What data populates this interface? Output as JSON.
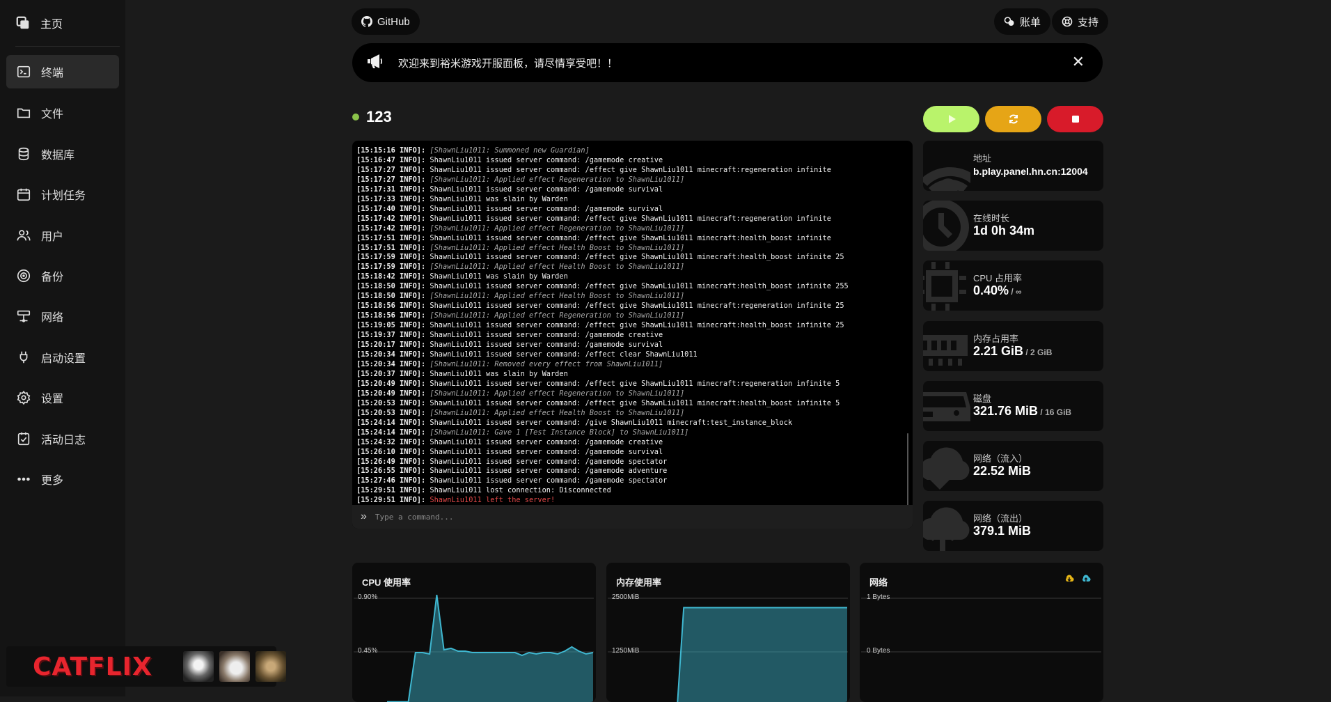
{
  "sidebar": {
    "home_label": "主页",
    "items": [
      {
        "label": "终端"
      },
      {
        "label": "文件"
      },
      {
        "label": "数据库"
      },
      {
        "label": "计划任务"
      },
      {
        "label": "用户"
      },
      {
        "label": "备份"
      },
      {
        "label": "网络"
      },
      {
        "label": "启动设置"
      },
      {
        "label": "设置"
      },
      {
        "label": "活动日志"
      },
      {
        "label": "更多"
      }
    ],
    "ad_text": "CATFLIX"
  },
  "topbar": {
    "github_label": "GitHub",
    "billing_label": "账单",
    "support_label": "支持"
  },
  "announcement": {
    "text": "欢迎来到裕米游戏开服面板，请尽情享受吧！！",
    "close_symbol": "✕"
  },
  "server": {
    "name": "123",
    "status_color": "#8bc34a"
  },
  "controls": {
    "start_color": "#b9f36b",
    "restart_color": "#e6a516",
    "stop_color": "#d81b2a"
  },
  "console": {
    "lines": [
      {
        "ts": "[15:15:16 INFO]:",
        "msg": " [ShawnLiu1011: Summoned new Guardian]",
        "style": "italic"
      },
      {
        "ts": "[15:16:47 INFO]:",
        "msg": " ShawnLiu1011 issued server command: /gamemode creative",
        "style": ""
      },
      {
        "ts": "[15:17:27 INFO]:",
        "msg": " ShawnLiu1011 issued server command: /effect give ShawnLiu1011 minecraft:regeneration infinite",
        "style": ""
      },
      {
        "ts": "[15:17:27 INFO]:",
        "msg": " [ShawnLiu1011: Applied effect Regeneration to ShawnLiu1011]",
        "style": "italic"
      },
      {
        "ts": "[15:17:31 INFO]:",
        "msg": " ShawnLiu1011 issued server command: /gamemode survival",
        "style": ""
      },
      {
        "ts": "[15:17:33 INFO]:",
        "msg": " ShawnLiu1011 was slain by Warden",
        "style": ""
      },
      {
        "ts": "[15:17:40 INFO]:",
        "msg": " ShawnLiu1011 issued server command: /gamemode survival",
        "style": ""
      },
      {
        "ts": "[15:17:42 INFO]:",
        "msg": " ShawnLiu1011 issued server command: /effect give ShawnLiu1011 minecraft:regeneration infinite",
        "style": ""
      },
      {
        "ts": "[15:17:42 INFO]:",
        "msg": " [ShawnLiu1011: Applied effect Regeneration to ShawnLiu1011]",
        "style": "italic"
      },
      {
        "ts": "[15:17:51 INFO]:",
        "msg": " ShawnLiu1011 issued server command: /effect give ShawnLiu1011 minecraft:health_boost infinite",
        "style": ""
      },
      {
        "ts": "[15:17:51 INFO]:",
        "msg": " [ShawnLiu1011: Applied effect Health Boost to ShawnLiu1011]",
        "style": "italic"
      },
      {
        "ts": "[15:17:59 INFO]:",
        "msg": " ShawnLiu1011 issued server command: /effect give ShawnLiu1011 minecraft:health_boost infinite 25",
        "style": ""
      },
      {
        "ts": "[15:17:59 INFO]:",
        "msg": " [ShawnLiu1011: Applied effect Health Boost to ShawnLiu1011]",
        "style": "italic"
      },
      {
        "ts": "[15:18:42 INFO]:",
        "msg": " ShawnLiu1011 was slain by Warden",
        "style": ""
      },
      {
        "ts": "[15:18:50 INFO]:",
        "msg": " ShawnLiu1011 issued server command: /effect give ShawnLiu1011 minecraft:health_boost infinite 255",
        "style": ""
      },
      {
        "ts": "[15:18:50 INFO]:",
        "msg": " [ShawnLiu1011: Applied effect Health Boost to ShawnLiu1011]",
        "style": "italic"
      },
      {
        "ts": "[15:18:56 INFO]:",
        "msg": " ShawnLiu1011 issued server command: /effect give ShawnLiu1011 minecraft:regeneration infinite 25",
        "style": ""
      },
      {
        "ts": "[15:18:56 INFO]:",
        "msg": " [ShawnLiu1011: Applied effect Regeneration to ShawnLiu1011]",
        "style": "italic"
      },
      {
        "ts": "[15:19:05 INFO]:",
        "msg": " ShawnLiu1011 issued server command: /effect give ShawnLiu1011 minecraft:health_boost infinite 25",
        "style": ""
      },
      {
        "ts": "[15:19:37 INFO]:",
        "msg": " ShawnLiu1011 issued server command: /gamemode creative",
        "style": ""
      },
      {
        "ts": "[15:20:17 INFO]:",
        "msg": " ShawnLiu1011 issued server command: /gamemode survival",
        "style": ""
      },
      {
        "ts": "[15:20:34 INFO]:",
        "msg": " ShawnLiu1011 issued server command: /effect clear ShawnLiu1011",
        "style": ""
      },
      {
        "ts": "[15:20:34 INFO]:",
        "msg": " [ShawnLiu1011: Removed every effect from ShawnLiu1011]",
        "style": "italic"
      },
      {
        "ts": "[15:20:37 INFO]:",
        "msg": " ShawnLiu1011 was slain by Warden",
        "style": ""
      },
      {
        "ts": "[15:20:49 INFO]:",
        "msg": " ShawnLiu1011 issued server command: /effect give ShawnLiu1011 minecraft:regeneration infinite 5",
        "style": ""
      },
      {
        "ts": "[15:20:49 INFO]:",
        "msg": " [ShawnLiu1011: Applied effect Regeneration to ShawnLiu1011]",
        "style": "italic"
      },
      {
        "ts": "[15:20:53 INFO]:",
        "msg": " ShawnLiu1011 issued server command: /effect give ShawnLiu1011 minecraft:health_boost infinite 5",
        "style": ""
      },
      {
        "ts": "[15:20:53 INFO]:",
        "msg": " [ShawnLiu1011: Applied effect Health Boost to ShawnLiu1011]",
        "style": "italic"
      },
      {
        "ts": "[15:24:14 INFO]:",
        "msg": " ShawnLiu1011 issued server command: /give ShawnLiu1011 minecraft:test_instance_block",
        "style": ""
      },
      {
        "ts": "[15:24:14 INFO]:",
        "msg": " [ShawnLiu1011: Gave 1 [Test Instance Block] to ShawnLiu1011]",
        "style": "italic"
      },
      {
        "ts": "[15:24:32 INFO]:",
        "msg": " ShawnLiu1011 issued server command: /gamemode creative",
        "style": ""
      },
      {
        "ts": "[15:26:10 INFO]:",
        "msg": " ShawnLiu1011 issued server command: /gamemode survival",
        "style": ""
      },
      {
        "ts": "[15:26:49 INFO]:",
        "msg": " ShawnLiu1011 issued server command: /gamemode spectator",
        "style": ""
      },
      {
        "ts": "[15:26:55 INFO]:",
        "msg": " ShawnLiu1011 issued server command: /gamemode adventure",
        "style": ""
      },
      {
        "ts": "[15:27:46 INFO]:",
        "msg": " ShawnLiu1011 issued server command: /gamemode spectator",
        "style": ""
      },
      {
        "ts": "[15:29:51 INFO]:",
        "msg": " ShawnLiu1011 lost connection: Disconnected",
        "style": ""
      },
      {
        "ts": "[15:29:51 INFO]:",
        "msg": " ShawnLiu1011 left the server!",
        "style": "red"
      }
    ],
    "input_placeholder": "Type a command..."
  },
  "stats": [
    {
      "label": "地址",
      "value": "b.play.panel.hn.cn:12004",
      "sub": "",
      "icon": "wifi-icon"
    },
    {
      "label": "在线时长",
      "value": "1d 0h 34m",
      "sub": "",
      "icon": "clock-icon"
    },
    {
      "label": "CPU 占用率",
      "value": "0.40%",
      "sub": " / ∞",
      "icon": "cpu-icon"
    },
    {
      "label": "内存占用率",
      "value": "2.21 GiB",
      "sub": " / 2 GiB",
      "icon": "memory-icon"
    },
    {
      "label": "磁盘",
      "value": "321.76 MiB",
      "sub": " / 16 GiB",
      "icon": "disk-icon"
    },
    {
      "label": "网络（流入）",
      "value": "22.52 MiB",
      "sub": "",
      "icon": "download-cloud-icon"
    },
    {
      "label": "网络（流出）",
      "value": "379.1 MiB",
      "sub": "",
      "icon": "upload-cloud-icon"
    }
  ],
  "charts": {
    "accent": "#3fb7d0",
    "legend_colors": [
      "#e6b516",
      "#3fb7d0"
    ]
  },
  "chart_data": [
    {
      "type": "area",
      "title": "CPU 使用率",
      "y_ticks": [
        "0.90%",
        "0.45%"
      ],
      "ylim": [
        0,
        0.9
      ],
      "grid": true,
      "values": [
        0.1,
        0.1,
        0.1,
        0.1,
        0.45,
        0.45,
        0.44,
        0.86,
        0.47,
        0.48,
        0.46,
        0.46,
        0.45,
        0.45,
        0.45,
        0.45,
        0.45,
        0.45,
        0.45,
        0.43,
        0.45,
        0.44,
        0.45,
        0.45,
        0.44,
        0.46,
        0.49,
        0.46,
        0.44,
        0.45
      ]
    },
    {
      "type": "area",
      "title": "内存使用率",
      "y_ticks": [
        "2500MiB",
        "1250MiB"
      ],
      "ylim": [
        0,
        2500
      ],
      "grid": true,
      "values": [
        0,
        0,
        0,
        0,
        0,
        0,
        2300,
        2300,
        2300,
        2300,
        2300,
        2300,
        2300,
        2300,
        2300,
        2300,
        2300,
        2300,
        2300,
        2300,
        2300,
        2300,
        2300,
        2300,
        2300,
        2300,
        2300,
        2300,
        2300,
        2300
      ]
    },
    {
      "type": "line",
      "title": "网络",
      "y_ticks": [
        "1 Bytes",
        "0 Bytes"
      ],
      "ylim": [
        0,
        1
      ],
      "grid": true,
      "series": [
        {
          "values": []
        },
        {
          "values": []
        }
      ]
    }
  ]
}
